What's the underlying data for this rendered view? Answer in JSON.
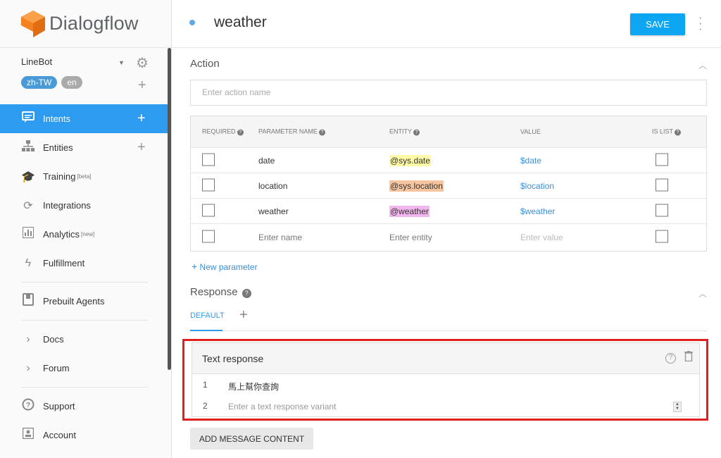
{
  "brand": {
    "name": "Dialogflow"
  },
  "agent": {
    "name": "LineBot",
    "languages": [
      "zh-TW",
      "en"
    ]
  },
  "nav": {
    "intents": "Intents",
    "entities": "Entities",
    "training": "Training",
    "training_tag": "[beta]",
    "integrations": "Integrations",
    "analytics": "Analytics",
    "analytics_tag": "[new]",
    "fulfillment": "Fulfillment",
    "prebuilt": "Prebuilt Agents",
    "docs": "Docs",
    "forum": "Forum",
    "support": "Support",
    "account": "Account"
  },
  "header": {
    "title": "weather",
    "save_label": "SAVE"
  },
  "action": {
    "title": "Action",
    "placeholder": "Enter action name"
  },
  "params": {
    "headers": {
      "required": "REQUIRED",
      "name": "PARAMETER NAME",
      "entity": "ENTITY",
      "value": "VALUE",
      "is_list": "IS LIST"
    },
    "rows": [
      {
        "name": "date",
        "entity": "@sys.date",
        "value": "$date",
        "entity_color": "#fff9a6"
      },
      {
        "name": "location",
        "entity": "@sys.location",
        "value": "$location",
        "entity_color": "#f6c59f"
      },
      {
        "name": "weather",
        "entity": "@weather",
        "value": "$weather",
        "entity_color": "#f2b6ef"
      }
    ],
    "placeholders": {
      "name": "Enter name",
      "entity": "Enter entity",
      "value": "Enter value"
    },
    "new_param": "New parameter"
  },
  "response": {
    "title": "Response",
    "tab_default": "DEFAULT",
    "card_title": "Text response",
    "rows": [
      {
        "num": "1",
        "text": "馬上幫你查詢"
      },
      {
        "num": "2",
        "placeholder": "Enter a text response variant"
      }
    ],
    "add_message": "ADD MESSAGE CONTENT"
  },
  "colors": {
    "accent": "#2d9bf0",
    "save": "#0ca6f3",
    "highlight_border": "#e02020"
  }
}
